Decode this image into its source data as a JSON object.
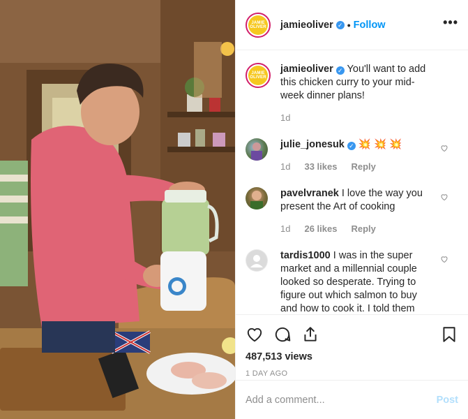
{
  "post": {
    "author": "jamieoliver",
    "avatar_text": [
      "JAMIE",
      "OLIVER"
    ],
    "verified_icon": "verified-badge",
    "separator": "•",
    "follow_label": "Follow",
    "more_label": "•••"
  },
  "caption": {
    "username": "jamieoliver",
    "text": "You'll want to add this chicken curry to your mid-week dinner plans!",
    "age": "1d"
  },
  "comments": [
    {
      "username": "julie_jonesuk",
      "verified": true,
      "text": "💥 💥 💥",
      "age": "1d",
      "likes": "33 likes",
      "reply": "Reply"
    },
    {
      "username": "pavelvranek",
      "verified": false,
      "text": "I love the way you present the Art of cooking",
      "age": "1d",
      "likes": "26 likes",
      "reply": "Reply"
    },
    {
      "username": "tardis1000",
      "verified": false,
      "text": "I was in the super market and a millennial couple looked so desperate. Trying to figure out which salmon to buy and how to cook it. I told them"
    }
  ],
  "actions": {
    "views": "487,513 views",
    "date": "1 DAY AGO",
    "comment_placeholder": "Add a comment...",
    "post_label": "Post"
  },
  "colors": {
    "accent": "#0095f6",
    "post_disabled": "#b2dffc",
    "verified": "#3897f0",
    "brand_ring": "#d11f6a",
    "brand_fill": "#f6c81f"
  }
}
